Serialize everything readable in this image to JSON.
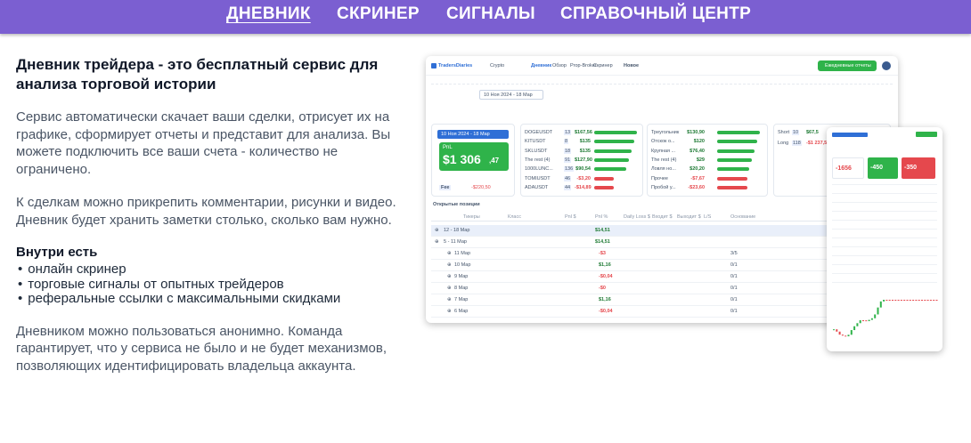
{
  "nav": {
    "items": [
      "ДНЕВНИК",
      "СКРИНЕР",
      "СИГНАЛЫ",
      "СПРАВОЧНЫЙ ЦЕНТР"
    ],
    "active": "ДНЕВНИК"
  },
  "intro": {
    "headline": "Дневник трейдера - это бесплатный сервис для анализа торговой истории",
    "para1": "Сервис автоматически скачает ваши сделки, отрисует их на графике, сформирует отчеты и представит для анализа. Вы можете подключить все ваши счета - количество не ограничено.",
    "para2": "К сделкам можно прикрепить комментарии, рисунки и видео. Дневник будет хранить заметки столько, сколько вам нужно.",
    "inside_title": "Внутри есть",
    "inside_items": [
      "онлайн скринер",
      "торговые сигналы от опытных трейдеров",
      "реферальные ссылки с максимальными скидками"
    ],
    "para3": "Дневником можно пользоваться анонимно. Команда гарантирует, что у сервиса не было и не будет механизмов, позволяющих идентифицировать владельца аккаунта."
  },
  "shot": {
    "logo": "TradersDiaries",
    "coin": "Crypto",
    "tabs": [
      "Дневник",
      "Обзор",
      "Prop-Broker",
      "Скринер"
    ],
    "news": "Новое",
    "report_button": "Ежедневные отчеты",
    "date_range": "10 Ноя 2024 - 18 Мар",
    "pnl_label": "PnL",
    "pnl_value": "$1 306",
    "pnl_cents": ",47",
    "fee_label": "Fee",
    "fee_value": "-$220,50",
    "tickers": [
      {
        "name": "DOGEUSDT",
        "n": "13",
        "v": "$167,56"
      },
      {
        "name": "KITUSDT",
        "n": "8",
        "v": "$135"
      },
      {
        "name": "SKLUSDT",
        "n": "18",
        "v": "$135"
      },
      {
        "name": "The rest (4)",
        "n": "91",
        "v": "$127,90"
      },
      {
        "name": "1000LUNC...",
        "n": "136",
        "v": "$90,54"
      },
      {
        "name": "TOMIUSDT",
        "n": "46",
        "v": "-$3,20"
      },
      {
        "name": "ADAUSDT",
        "n": "44",
        "v": "-$14,89"
      }
    ],
    "setups": [
      {
        "name": "Треугольник",
        "v": "$130,90"
      },
      {
        "name": "Отскок о...",
        "v": "$120"
      },
      {
        "name": "Крупная ...",
        "v": "$76,40"
      },
      {
        "name": "The rest (4)",
        "v": "$29"
      },
      {
        "name": "Ловля но...",
        "v": "$20,20"
      },
      {
        "name": "Прочее",
        "v": "-$7,67"
      },
      {
        "name": "Пробой у...",
        "v": "-$23,60"
      }
    ],
    "side": [
      {
        "name": "Short",
        "n": "10",
        "v": "$67,5"
      },
      {
        "name": "Long",
        "n": "118",
        "v": "-$1 237,5"
      }
    ],
    "open_positions": "Открытые позиции",
    "table_headers": [
      "Тикеры",
      "Класс",
      "Pnl $",
      "Pnl %",
      "Daily Loss $",
      "Входит $",
      "Выходит $",
      "L/S",
      "Основание"
    ],
    "groups": [
      {
        "label": "12 - 18 Мар",
        "pnl": "$14,51"
      },
      {
        "label": "5 - 11 Мар",
        "pnl": "$14,51"
      }
    ],
    "days": [
      {
        "label": "11 Мар",
        "pnl": "-$3",
        "ls": "3/5"
      },
      {
        "label": "10 Мар",
        "pnl": "$1,16",
        "ls": "0/1"
      },
      {
        "label": "9 Мар",
        "pnl": "-$0,04",
        "ls": "0/1"
      },
      {
        "label": "8 Мар",
        "pnl": "-$0",
        "ls": "0/1"
      },
      {
        "label": "7 Мар",
        "pnl": "$1,16",
        "ls": "0/1"
      },
      {
        "label": "6 Мар",
        "pnl": "-$0,04",
        "ls": "0/1"
      }
    ]
  },
  "phone": {
    "vals": [
      "-1656",
      "-450",
      "-350"
    ],
    "mini": [
      "+1,5",
      "+2,75",
      "+4,75"
    ]
  },
  "colors": {
    "nav_bg": "#7b5fd1",
    "accent_green": "#2fb34a",
    "accent_red": "#e5484d",
    "date_blue": "#2f6fd6"
  }
}
